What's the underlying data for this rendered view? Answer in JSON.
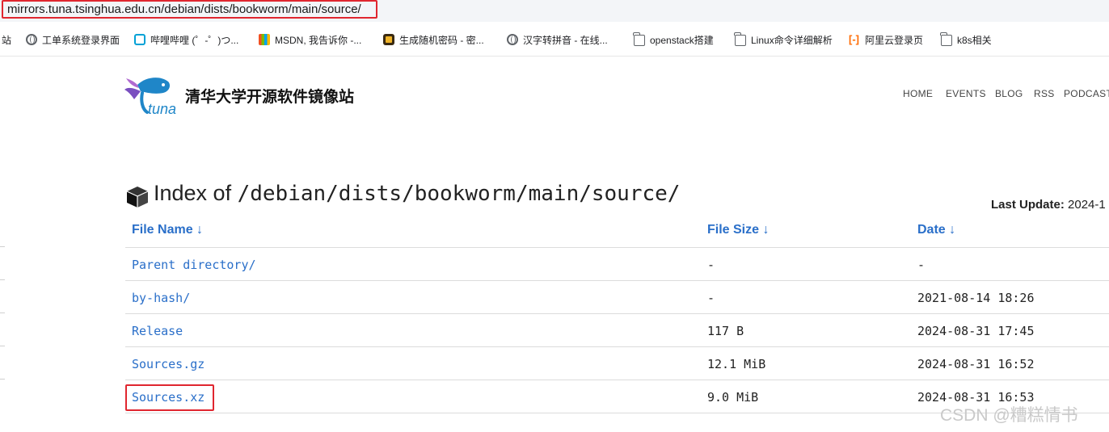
{
  "browser": {
    "url": "mirrors.tuna.tsinghua.edu.cn/debian/dists/bookworm/main/source/",
    "bookmarks": [
      {
        "label": "站",
        "icon": "none"
      },
      {
        "label": "工单系统登录界面",
        "icon": "globe-icon"
      },
      {
        "label": "哔哩哔哩 (゜-゜)つ...",
        "icon": "bilibili-icon"
      },
      {
        "label": "MSDN, 我告诉你 -...",
        "icon": "msdn-icon"
      },
      {
        "label": "生成随机密码 - 密...",
        "icon": "password-generator-icon"
      },
      {
        "label": "汉字转拼音 - 在线...",
        "icon": "globe-icon"
      },
      {
        "label": "openstack搭建",
        "icon": "folder-icon"
      },
      {
        "label": "Linux命令详细解析",
        "icon": "folder-icon"
      },
      {
        "label": "阿里云登录页",
        "icon": "aliyun-icon"
      },
      {
        "label": "k8s相关",
        "icon": "folder-icon"
      }
    ]
  },
  "site": {
    "logo_text": "tuna",
    "title": "清华大学开源软件镜像站",
    "nav": [
      "HOME",
      "EVENTS",
      "BLOG",
      "RSS",
      "PODCAST"
    ]
  },
  "index": {
    "prefix": "Index of ",
    "path": "/debian/dists/bookworm/main/source/",
    "last_update_label": "Last Update:",
    "last_update_value": "2024-1",
    "headers": {
      "name": "File Name ↓",
      "size": "File Size ↓",
      "date": "Date ↓"
    },
    "rows": [
      {
        "name": "Parent directory/",
        "size": "-",
        "date": "-"
      },
      {
        "name": "by-hash/",
        "size": "-",
        "date": "2021-08-14 18:26"
      },
      {
        "name": "Release",
        "size": "117 B",
        "date": "2024-08-31 17:45"
      },
      {
        "name": "Sources.gz",
        "size": "12.1 MiB",
        "date": "2024-08-31 16:52"
      },
      {
        "name": "Sources.xz",
        "size": "9.0 MiB",
        "date": "2024-08-31 16:53"
      }
    ]
  },
  "watermark": "CSDN @糟糕情书",
  "colors": {
    "link": "#2a6fc9",
    "highlight_box": "#e0262f",
    "logo_blue": "#1f86c8"
  }
}
